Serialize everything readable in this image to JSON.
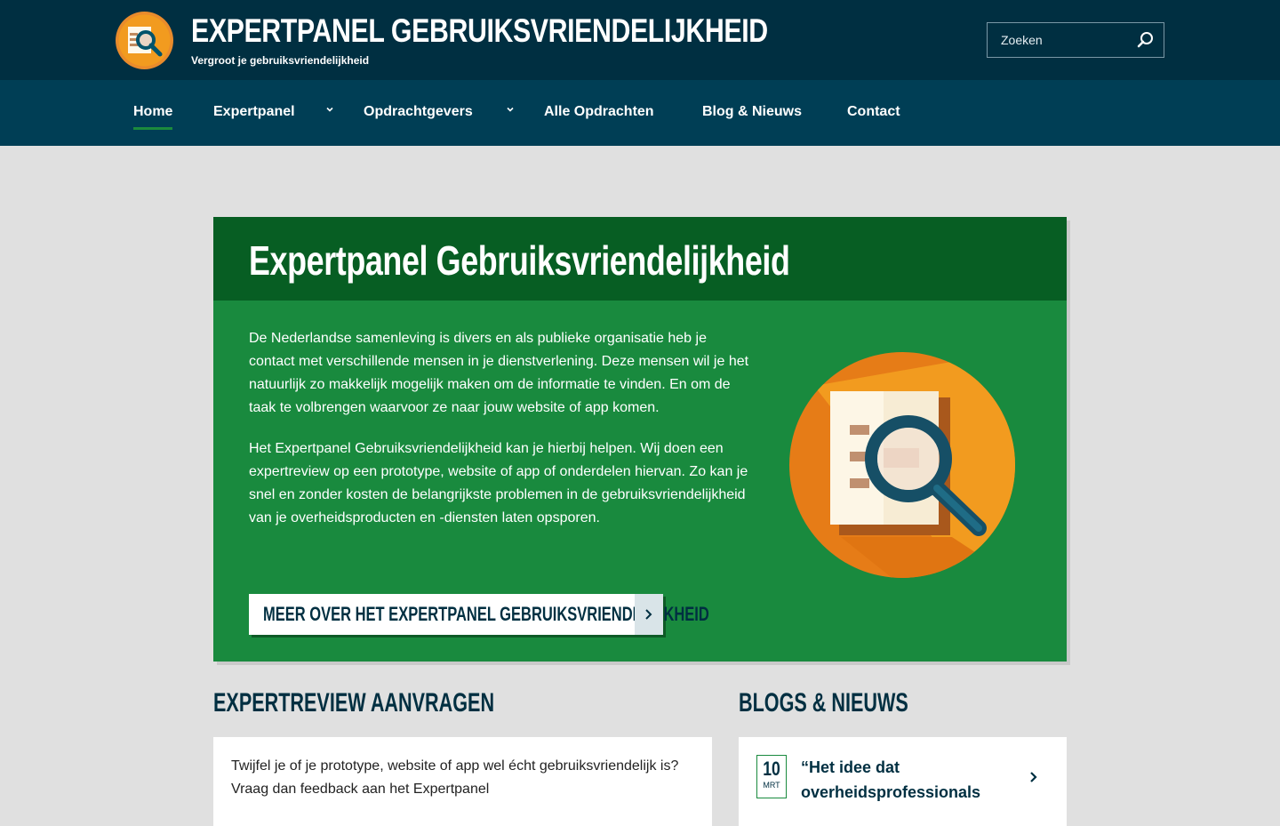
{
  "header": {
    "title": "EXPERTPANEL GEBRUIKSVRIENDELIJKHEID",
    "tagline": "Vergroot je gebruiksvriendelijkheid",
    "search_placeholder": "Zoeken",
    "logo_icon": "document-magnifier-icon",
    "search_icon": "search-icon"
  },
  "nav": {
    "items": [
      {
        "label": "Home",
        "active": true
      },
      {
        "label": "Expertpanel",
        "has_dropdown": true
      },
      {
        "label": "Opdrachtgevers",
        "has_dropdown": true
      },
      {
        "label": "Alle Opdrachten"
      },
      {
        "label": "Blog & Nieuws"
      },
      {
        "label": "Contact"
      }
    ]
  },
  "hero": {
    "title": "Expertpanel Gebruiksvriendelijkheid",
    "paragraphs": [
      "De Nederlandse samenleving is divers en als publieke organisatie heb je contact met verschillende mensen in je dienstverlening. Deze mensen wil je het natuurlijk zo makkelijk mogelijk maken om de informatie te vinden. En om de taak te volbrengen waarvoor ze naar jouw website of app komen.",
      "Het Expertpanel Gebruiksvriendelijkheid kan je hierbij helpen. Wij doen een expertreview op een prototype, website of app of onderdelen hiervan. Zo kan je snel en zonder kosten de belangrijkste problemen in de gebruiksvriendelijkheid van je overheidsproducten en -diensten laten opsporen."
    ],
    "cta_label": "MEER OVER HET EXPERTPANEL GEBRUIKSVRIENDELIJKHEID",
    "illustration_icon": "document-magnifier-illustration"
  },
  "review": {
    "heading": "EXPERTREVIEW AANVRAGEN",
    "text": "Twijfel je of je prototype, website of app wel écht gebruiksvriendelijk is? Vraag dan feedback aan het Expertpanel"
  },
  "news": {
    "heading": "BLOGS & NIEUWS",
    "items": [
      {
        "day": "10",
        "month": "MRT",
        "title": "“Het idee dat overheidsprofessionals"
      }
    ]
  },
  "colors": {
    "header_bg": "#002f41",
    "nav_bg": "#003e55",
    "hero_bg": "#198a3e",
    "hero_head_bg": "#075e23",
    "accent_orange": "#f29b1f",
    "page_bg": "#e0e0e0"
  }
}
